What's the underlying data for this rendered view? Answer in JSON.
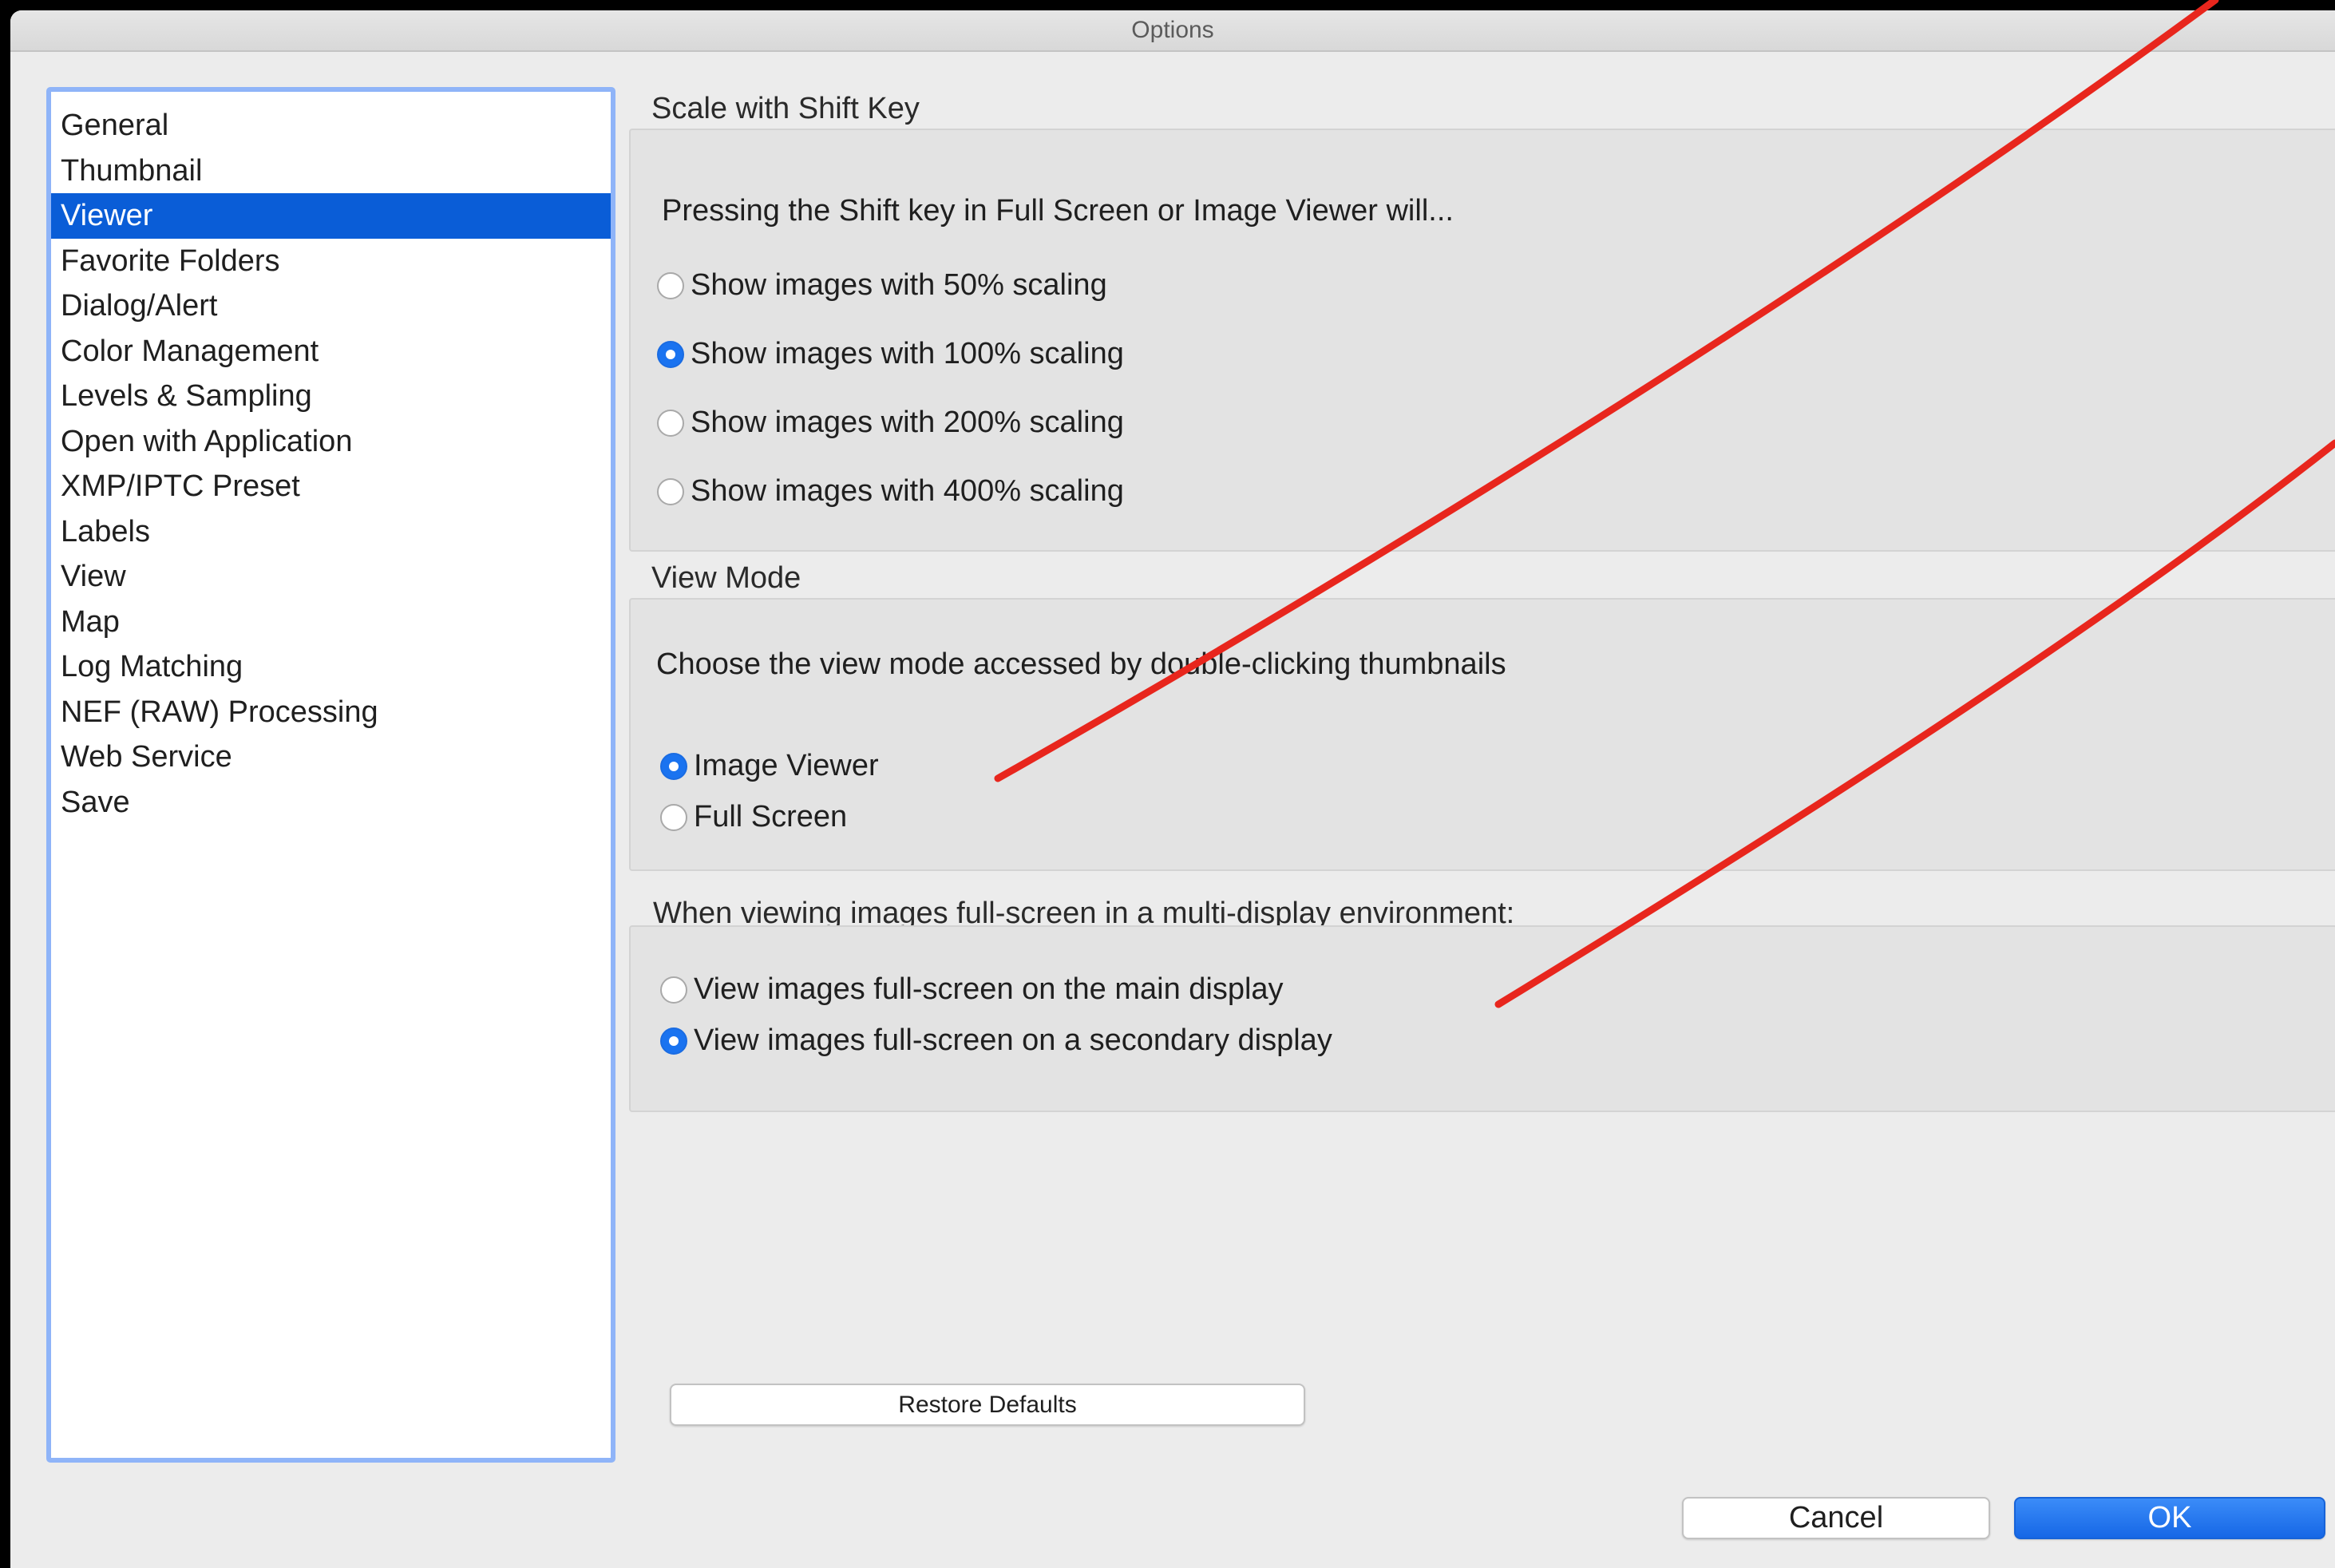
{
  "window": {
    "title": "Options"
  },
  "sidebar": {
    "items": [
      {
        "label": "General"
      },
      {
        "label": "Thumbnail"
      },
      {
        "label": "Viewer",
        "selected": true
      },
      {
        "label": "Favorite Folders"
      },
      {
        "label": "Dialog/Alert"
      },
      {
        "label": "Color Management"
      },
      {
        "label": "Levels & Sampling"
      },
      {
        "label": "Open with Application"
      },
      {
        "label": "XMP/IPTC Preset"
      },
      {
        "label": "Labels"
      },
      {
        "label": "View"
      },
      {
        "label": "Map"
      },
      {
        "label": "Log Matching"
      },
      {
        "label": "NEF (RAW) Processing"
      },
      {
        "label": "Web Service"
      },
      {
        "label": "Save"
      }
    ]
  },
  "scale": {
    "heading": "Scale with Shift Key",
    "description": "Pressing the Shift key in Full Screen or Image Viewer will...",
    "options": [
      {
        "label": "Show images with 50% scaling",
        "checked": false
      },
      {
        "label": "Show images with 100% scaling",
        "checked": true
      },
      {
        "label": "Show images with 200% scaling",
        "checked": false
      },
      {
        "label": "Show images with 400% scaling",
        "checked": false
      }
    ]
  },
  "view_mode": {
    "heading": "View Mode",
    "description": "Choose the view mode accessed by double-clicking thumbnails",
    "options": [
      {
        "label": "Image Viewer",
        "checked": true
      },
      {
        "label": "Full Screen",
        "checked": false
      }
    ]
  },
  "multi_display": {
    "heading": "When viewing images full-screen in a multi-display environment:",
    "options": [
      {
        "label": "View images full-screen on the main display",
        "checked": false
      },
      {
        "label": "View images full-screen on a secondary display",
        "checked": true
      }
    ]
  },
  "buttons": {
    "restore_defaults": "Restore Defaults",
    "cancel": "Cancel",
    "ok": "OK"
  },
  "colors": {
    "selection": "#0a5dd7",
    "accent": "#1a73f0",
    "annotation": "#e8261d"
  }
}
